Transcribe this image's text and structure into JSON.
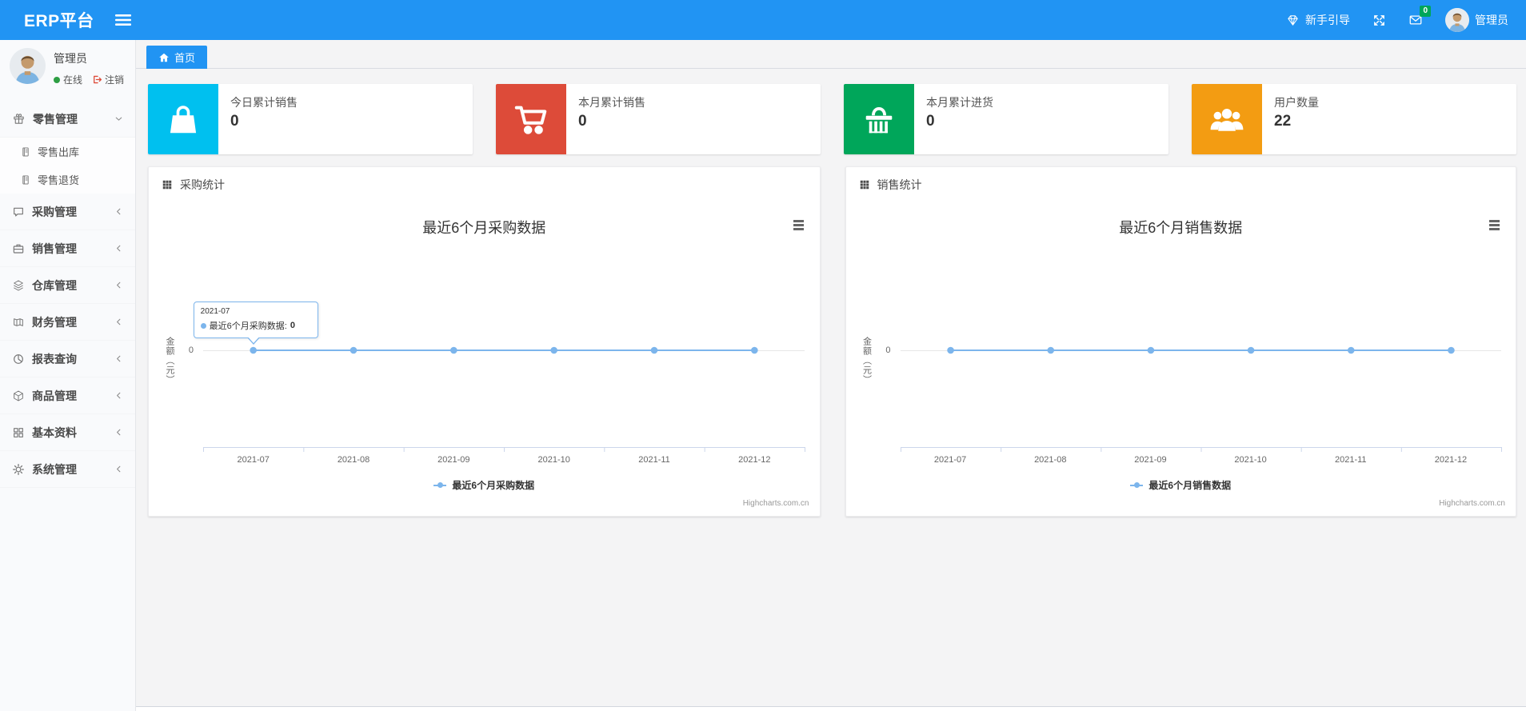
{
  "colors": {
    "accent": "#2194f3",
    "aqua": "#00c0ef",
    "red": "#dd4b39",
    "green": "#00a65a",
    "orange": "#f39c12",
    "series_line": "#7cb5ec"
  },
  "navbar": {
    "brand": "ERP平台",
    "menu_icon": "bars-icon",
    "guide": {
      "icon": "diamond-icon",
      "label": "新手引导"
    },
    "fullscreen_icon": "expand-icon",
    "messages": {
      "icon": "envelope-icon",
      "badge": "0"
    },
    "user": {
      "name": "管理员",
      "icon": "avatar"
    }
  },
  "sidebar": {
    "user": {
      "name": "管理员",
      "status_label": "在线",
      "logout_label": "注销"
    },
    "menu": [
      {
        "key": "retail",
        "label": "零售管理",
        "icon": "gift-icon",
        "state": "expanded",
        "caret": "chevron-down-icon",
        "children": [
          {
            "key": "retail-outbound",
            "label": "零售出库",
            "icon": "file-icon"
          },
          {
            "key": "retail-return",
            "label": "零售退货",
            "icon": "file-icon"
          }
        ]
      },
      {
        "key": "purchase",
        "label": "采购管理",
        "icon": "comment-icon",
        "caret": "chevron-left-icon"
      },
      {
        "key": "sales",
        "label": "销售管理",
        "icon": "briefcase-icon",
        "caret": "chevron-left-icon"
      },
      {
        "key": "warehouse",
        "label": "仓库管理",
        "icon": "layers-icon",
        "caret": "chevron-left-icon"
      },
      {
        "key": "finance",
        "label": "财务管理",
        "icon": "book-icon",
        "caret": "chevron-left-icon"
      },
      {
        "key": "reports",
        "label": "报表查询",
        "icon": "pie-chart-icon",
        "caret": "chevron-left-icon"
      },
      {
        "key": "goods",
        "label": "商品管理",
        "icon": "cube-icon",
        "caret": "chevron-left-icon"
      },
      {
        "key": "basic-data",
        "label": "基本资料",
        "icon": "grid-icon",
        "caret": "chevron-left-icon"
      },
      {
        "key": "system",
        "label": "系统管理",
        "icon": "gear-icon",
        "caret": "chevron-left-icon"
      }
    ]
  },
  "tabs": [
    {
      "key": "home",
      "icon": "home-icon",
      "label": "首页",
      "active": true
    }
  ],
  "stat_cards": [
    {
      "key": "today-sales",
      "label": "今日累计销售",
      "value": "0",
      "icon": "shopping-bag-icon",
      "color": "#00c0ef"
    },
    {
      "key": "month-sales",
      "label": "本月累计销售",
      "value": "0",
      "icon": "shopping-cart-icon",
      "color": "#dd4b39"
    },
    {
      "key": "month-purchase",
      "label": "本月累计进货",
      "value": "0",
      "icon": "shopping-basket-icon",
      "color": "#00a65a"
    },
    {
      "key": "user-count",
      "label": "用户数量",
      "value": "22",
      "icon": "users-icon",
      "color": "#f39c12"
    }
  ],
  "panels": [
    {
      "key": "purchase-stats",
      "icon": "th-icon",
      "title": "采购统计"
    },
    {
      "key": "sales-stats",
      "icon": "th-icon",
      "title": "销售统计"
    }
  ],
  "chart_data": [
    {
      "key": "purchase",
      "type": "line",
      "title": "最近6个月采购数据",
      "categories": [
        "2021-07",
        "2021-08",
        "2021-09",
        "2021-10",
        "2021-11",
        "2021-12"
      ],
      "series": [
        {
          "name": "最近6个月采购数据",
          "values": [
            0,
            0,
            0,
            0,
            0,
            0
          ],
          "color": "#7cb5ec"
        }
      ],
      "ylabel": "金额（元）",
      "yticks": [
        "0"
      ],
      "ylim": [
        -1,
        1
      ],
      "grid": true,
      "legend_position": "bottom",
      "credits": "Highcharts.com.cn",
      "tooltip": {
        "visible": true,
        "category": "2021-07",
        "series": "最近6个月采购数据",
        "value": "0"
      }
    },
    {
      "key": "sales",
      "type": "line",
      "title": "最近6个月销售数据",
      "categories": [
        "2021-07",
        "2021-08",
        "2021-09",
        "2021-10",
        "2021-11",
        "2021-12"
      ],
      "series": [
        {
          "name": "最近6个月销售数据",
          "values": [
            0,
            0,
            0,
            0,
            0,
            0
          ],
          "color": "#7cb5ec"
        }
      ],
      "ylabel": "金额（元）",
      "yticks": [
        "0"
      ],
      "ylim": [
        -1,
        1
      ],
      "grid": true,
      "legend_position": "bottom",
      "credits": "Highcharts.com.cn",
      "tooltip": {
        "visible": false
      }
    }
  ]
}
